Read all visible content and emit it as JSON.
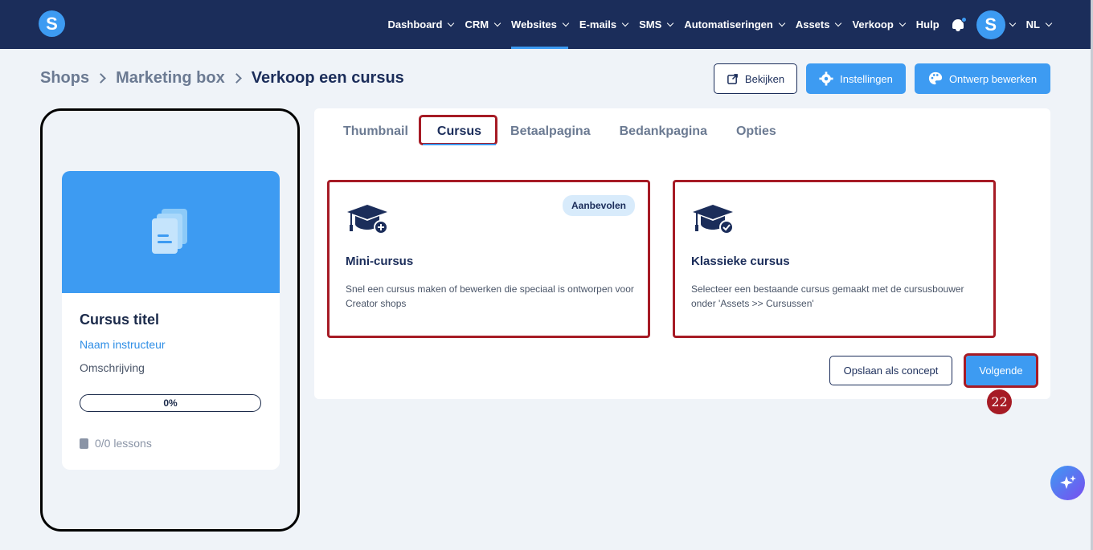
{
  "nav": {
    "items": [
      {
        "label": "Dashboard",
        "chevron": true,
        "active": false
      },
      {
        "label": "CRM",
        "chevron": true,
        "active": false
      },
      {
        "label": "Websites",
        "chevron": true,
        "active": true
      },
      {
        "label": "E-mails",
        "chevron": true,
        "active": false
      },
      {
        "label": "SMS",
        "chevron": true,
        "active": false
      },
      {
        "label": "Automatiseringen",
        "chevron": true,
        "active": false
      },
      {
        "label": "Assets",
        "chevron": true,
        "active": false
      },
      {
        "label": "Verkoop",
        "chevron": true,
        "active": false
      },
      {
        "label": "Hulp",
        "chevron": false,
        "active": false
      }
    ],
    "logo_letter": "S",
    "avatar_letter": "S",
    "language": "NL"
  },
  "breadcrumb": {
    "items": [
      "Shops",
      "Marketing box",
      "Verkoop een cursus"
    ]
  },
  "header_buttons": {
    "view": "Bekijken",
    "settings": "Instellingen",
    "edit_design": "Ontwerp bewerken"
  },
  "preview": {
    "title": "Cursus titel",
    "instructor": "Naam instructeur",
    "description": "Omschrijving",
    "progress": "0%",
    "lessons": "0/0 lessons"
  },
  "tabs": [
    {
      "label": "Thumbnail",
      "active": false
    },
    {
      "label": "Cursus",
      "active": true
    },
    {
      "label": "Betaalpagina",
      "active": false
    },
    {
      "label": "Bedankpagina",
      "active": false
    },
    {
      "label": "Opties",
      "active": false
    }
  ],
  "options": {
    "mini": {
      "title": "Mini-cursus",
      "description": "Snel een cursus maken of bewerken die speciaal is ontworpen voor Creator shops",
      "badge": "Aanbevolen",
      "icon": "graduation-cap-plus-icon"
    },
    "classic": {
      "title": "Klassieke cursus",
      "description": "Selecteer een bestaande cursus gemaakt met de cursusbouwer onder 'Assets >> Cursussen'",
      "icon": "graduation-cap-check-icon"
    }
  },
  "actions": {
    "save_draft": "Opslaan als concept",
    "next": "Volgende"
  },
  "step_number": "22",
  "colors": {
    "topbar": "#1b2d5a",
    "accent": "#3d9bf2",
    "highlight": "#a61b25",
    "background": "#eff3f8"
  }
}
